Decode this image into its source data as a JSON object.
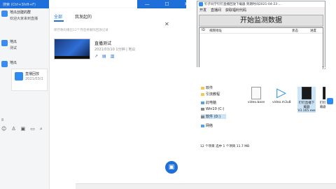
{
  "chat_app": {
    "search_hint": "搜索 (Ctrl+Shift+F)",
    "conversations": [
      {
        "name": "地瓜创建的群",
        "message": "欢迎大家来到直播"
      },
      {
        "name": "地瓜",
        "message": "测试"
      },
      {
        "name": "地瓜",
        "message": ""
      }
    ],
    "live_card": {
      "title": "直播回放",
      "date": "2021/03/1"
    },
    "timestamp": "8"
  },
  "live_panel": {
    "tab_all": "全部",
    "tab_mine": "我发起的",
    "notice": "保存数码播出12个月后将删除回放记录",
    "card": {
      "title": "直播测试",
      "meta": "2021/03/10 1分钟 | 地瓜"
    }
  },
  "monitor_tool": {
    "title": "钉子同学钉钉直播回放下载器  到期时间2021-04-23 ...",
    "menu": [
      "开发",
      "直播间",
      "获取福利代码"
    ],
    "start_button": "开始监测数据",
    "columns": [
      "ID",
      "视频地址",
      "状态",
      "进度"
    ]
  },
  "explorer": {
    "nav": [
      "软件",
      "引流教程",
      "此电脑",
      "Win10 (C:)",
      "软件 (D:)",
      "网络"
    ],
    "files": [
      {
        "name": "video.base"
      },
      {
        "name": "video.m3u8"
      },
      {
        "name": "钉钉直播下载器V3.165.exe"
      },
      {
        "name": "钉钉直播下载器V3.16"
      }
    ],
    "top_file": "7.exe",
    "status": "12 个项目    选中 1 个项目  11.7 MB"
  }
}
